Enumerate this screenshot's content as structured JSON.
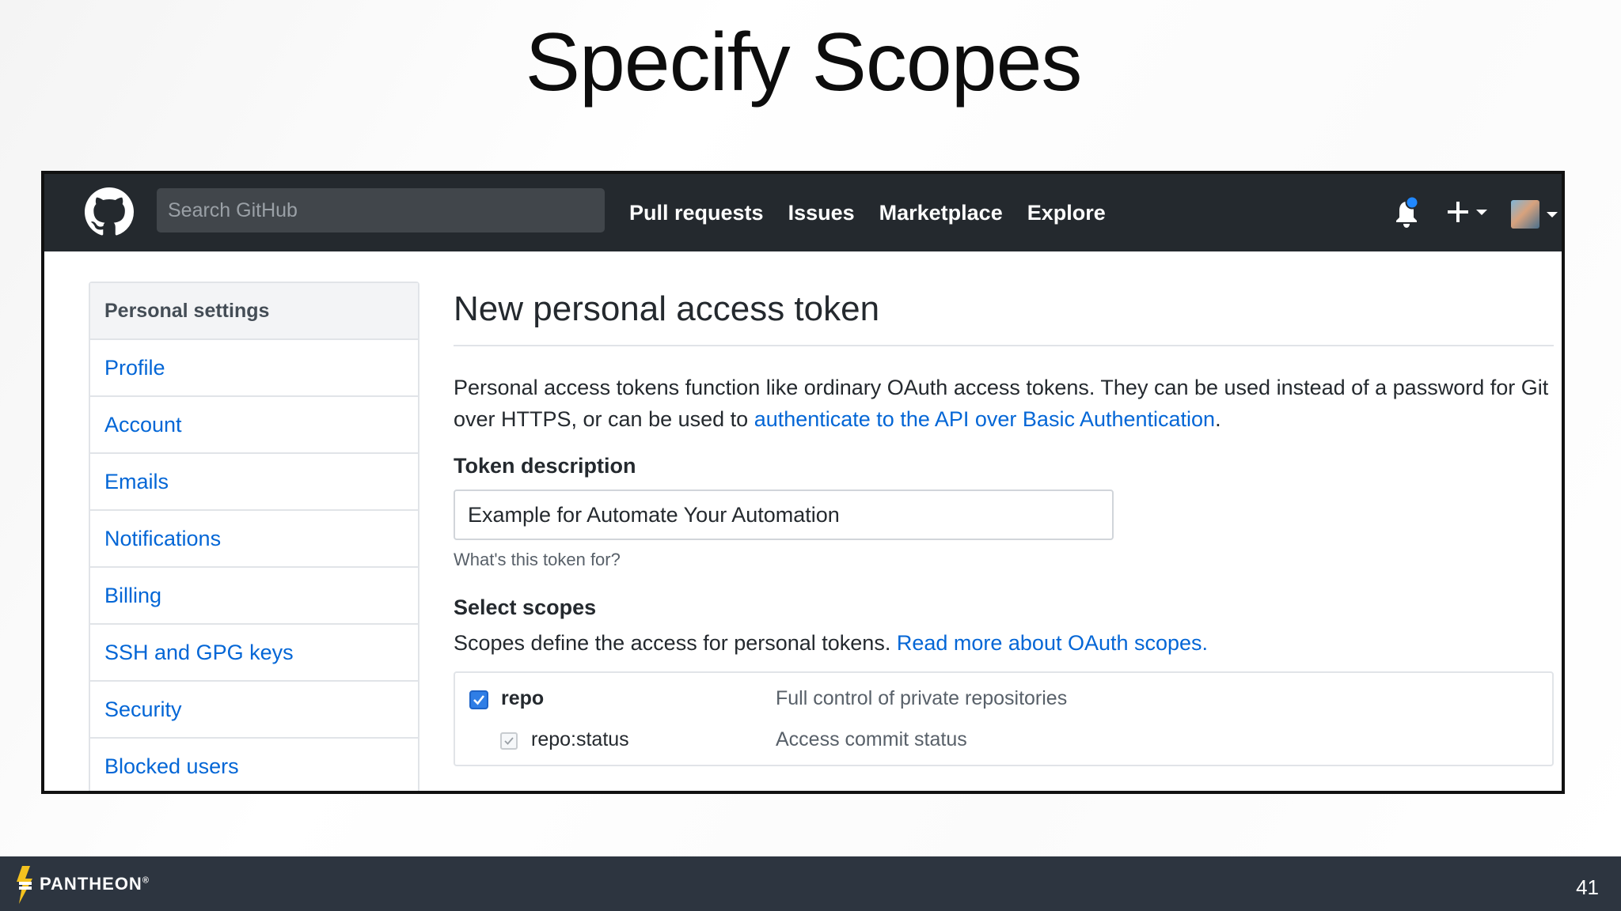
{
  "slide": {
    "title": "Specify Scopes",
    "page_number": "41",
    "brand": "PANTHEON",
    "brand_mark": "®"
  },
  "header": {
    "search_placeholder": "Search GitHub",
    "nav": [
      "Pull requests",
      "Issues",
      "Marketplace",
      "Explore"
    ],
    "icons": [
      "github-logo-icon",
      "bell-icon",
      "plus-icon",
      "avatar",
      "chevron-down-icon"
    ],
    "notification_dot_color": "#2188ff"
  },
  "sidebar": {
    "heading": "Personal settings",
    "items": [
      "Profile",
      "Account",
      "Emails",
      "Notifications",
      "Billing",
      "SSH and GPG keys",
      "Security",
      "Blocked users"
    ]
  },
  "main": {
    "title": "New personal access token",
    "intro_text": "Personal access tokens function like ordinary OAuth access tokens. They can be used instead of a password for Git over HTTPS, or can be used to ",
    "intro_link": "authenticate to the API over Basic Authentication",
    "intro_end": ".",
    "token_label": "Token description",
    "token_value": "Example for Automate Your Automation",
    "token_note": "What's this token for?",
    "scopes_label": "Select scopes",
    "scopes_text": "Scopes define the access for personal tokens. ",
    "scopes_link": "Read more about OAuth scopes.",
    "scopes": [
      {
        "name": "repo",
        "description": "Full control of private repositories",
        "checked": true
      },
      {
        "name": "repo:status",
        "description": "Access commit status",
        "checked": true
      }
    ]
  },
  "colors": {
    "link": "#0366d6",
    "header_bg": "#24292e",
    "footer_bg": "#2d3540",
    "checkbox": "#2f7ee6"
  }
}
